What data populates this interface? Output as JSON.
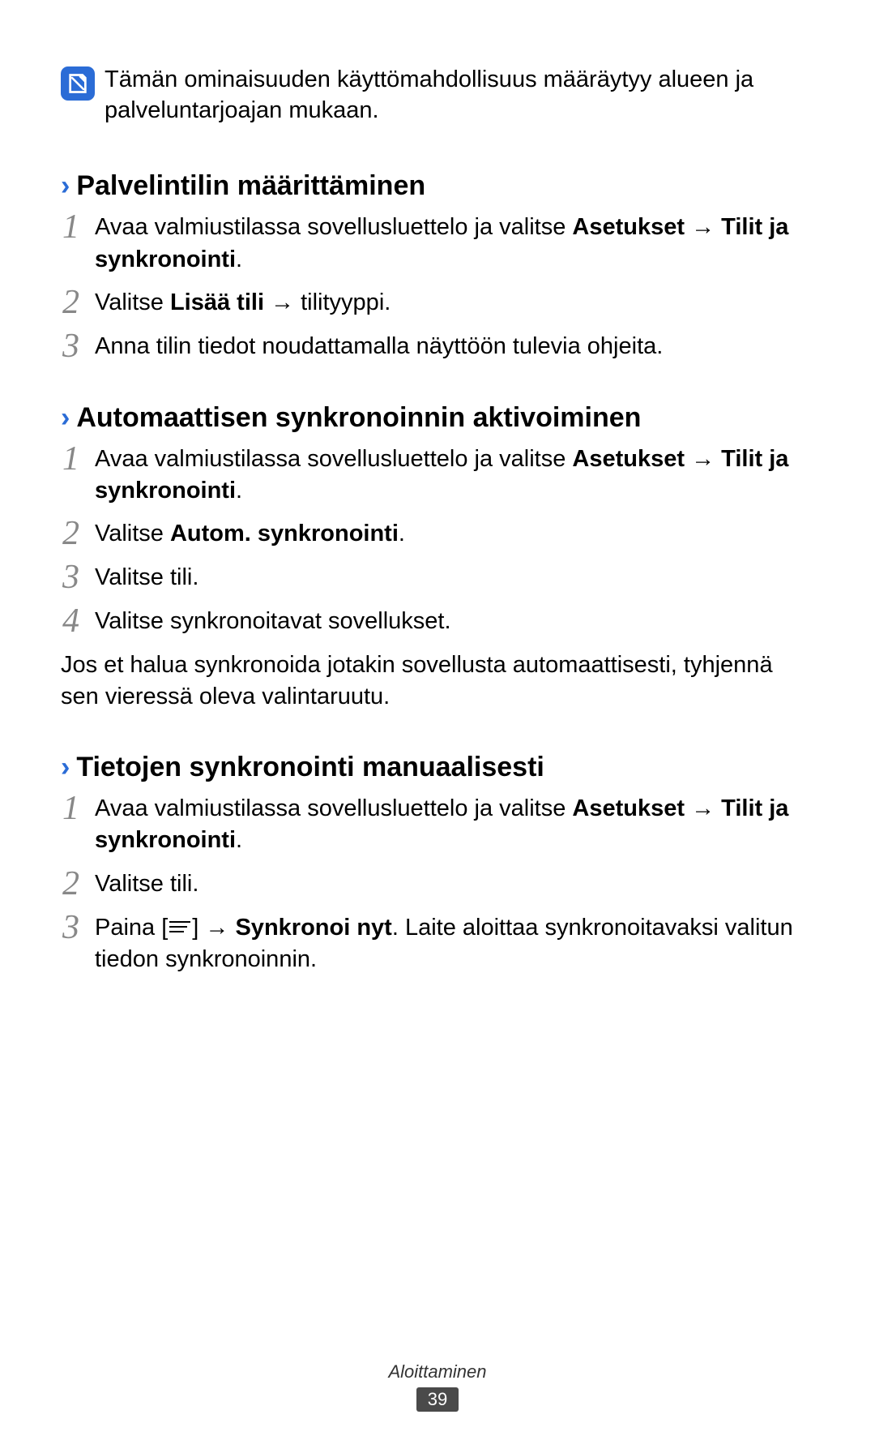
{
  "info_note": "Tämän ominaisuuden käyttömahdollisuus määräytyy alueen ja palveluntarjoajan mukaan.",
  "section1": {
    "title": "Palvelintilin määrittäminen",
    "steps": {
      "s1_pre": "Avaa valmiustilassa sovellusluettelo ja valitse ",
      "s1_b1": "Asetukset",
      "s1_arrow": " → ",
      "s1_b2": "Tilit ja synkronointi",
      "s1_post": ".",
      "s2_pre": "Valitse ",
      "s2_b1": "Lisää tili",
      "s2_post": " → tilityyppi.",
      "s3": "Anna tilin tiedot noudattamalla näyttöön tulevia ohjeita."
    }
  },
  "section2": {
    "title": "Automaattisen synkronoinnin aktivoiminen",
    "steps": {
      "s1_pre": "Avaa valmiustilassa sovellusluettelo ja valitse ",
      "s1_b1": "Asetukset",
      "s1_arrow": " → ",
      "s1_b2": "Tilit ja synkronointi",
      "s1_post": ".",
      "s2_pre": "Valitse ",
      "s2_b1": "Autom. synkronointi",
      "s2_post": ".",
      "s3": "Valitse tili.",
      "s4": "Valitse synkronoitavat sovellukset."
    },
    "body": "Jos et halua synkronoida jotakin sovellusta automaattisesti, tyhjennä sen vieressä oleva valintaruutu."
  },
  "section3": {
    "title": "Tietojen synkronointi manuaalisesti",
    "steps": {
      "s1_pre": "Avaa valmiustilassa sovellusluettelo ja valitse ",
      "s1_b1": "Asetukset",
      "s1_arrow": " → ",
      "s1_b2": "Tilit ja synkronointi",
      "s1_post": ".",
      "s2": "Valitse tili.",
      "s3_pre": "Paina [",
      "s3_mid": "] → ",
      "s3_b1": "Synkronoi nyt",
      "s3_post": ". Laite aloittaa synkronoitavaksi valitun tiedon synkronoinnin."
    }
  },
  "footer": {
    "section": "Aloittaminen",
    "page": "39"
  },
  "nums": {
    "n1": "1",
    "n2": "2",
    "n3": "3",
    "n4": "4"
  }
}
